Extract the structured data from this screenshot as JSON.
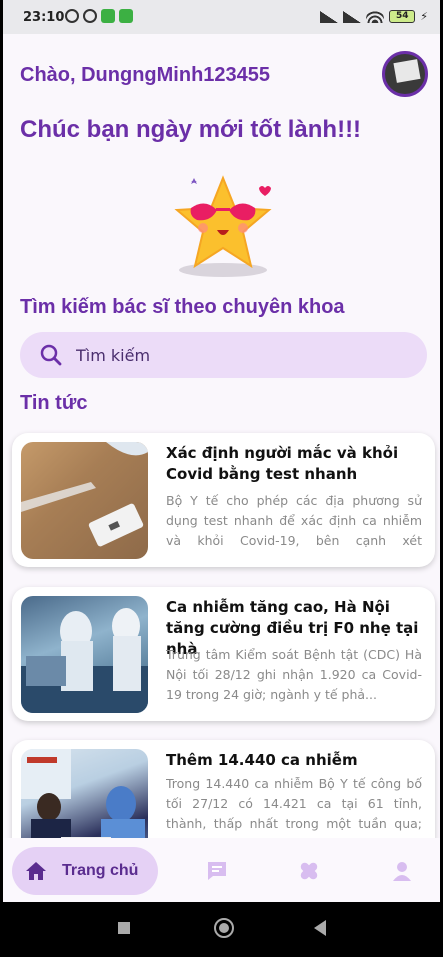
{
  "status_bar": {
    "time": "23:10",
    "battery": "54"
  },
  "header": {
    "greeting": "Chào, DungngMinh123455",
    "welcome": "Chúc bạn ngày mới tốt lành!!!"
  },
  "search": {
    "section_title": "Tìm kiếm bác sĩ theo chuyên khoa",
    "placeholder": "Tìm kiếm"
  },
  "news": {
    "section_title": "Tin tức",
    "items": [
      {
        "title": "Xác định người mắc và khỏi Covid bằng test nhanh",
        "desc": "Bộ Y tế cho phép các địa phương sử dụng test nhanh để xác định ca nhiễm và khỏi Covid-19, bên cạnh xét nghiệm..."
      },
      {
        "title": "Ca nhiễm tăng cao, Hà Nội tăng cường điều trị F0 nhẹ tại nhà",
        "desc": "Trung tâm Kiểm soát Bệnh tật (CDC) Hà Nội tối 28/12 ghi nhận 1.920 ca Covid-19 trong 24 giờ; ngành y tế phả..."
      },
      {
        "title": "Thêm 14.440 ca nhiễm",
        "desc": "Trong 14.440 ca nhiễm Bộ Y tế công bố tối 27/12 có 14.421 ca tại 61 tỉnh, thành, thấp nhất trong một tuần qua; Hà Nội..."
      }
    ]
  },
  "bottom_nav": {
    "home_label": "Trang chủ",
    "items": [
      "home-icon",
      "chat-icon",
      "bandage-icon",
      "profile-icon"
    ]
  },
  "colors": {
    "accent": "#6b2fa8",
    "search_bg": "#ecdcf8",
    "nav_active_bg": "#e5d1f5"
  }
}
